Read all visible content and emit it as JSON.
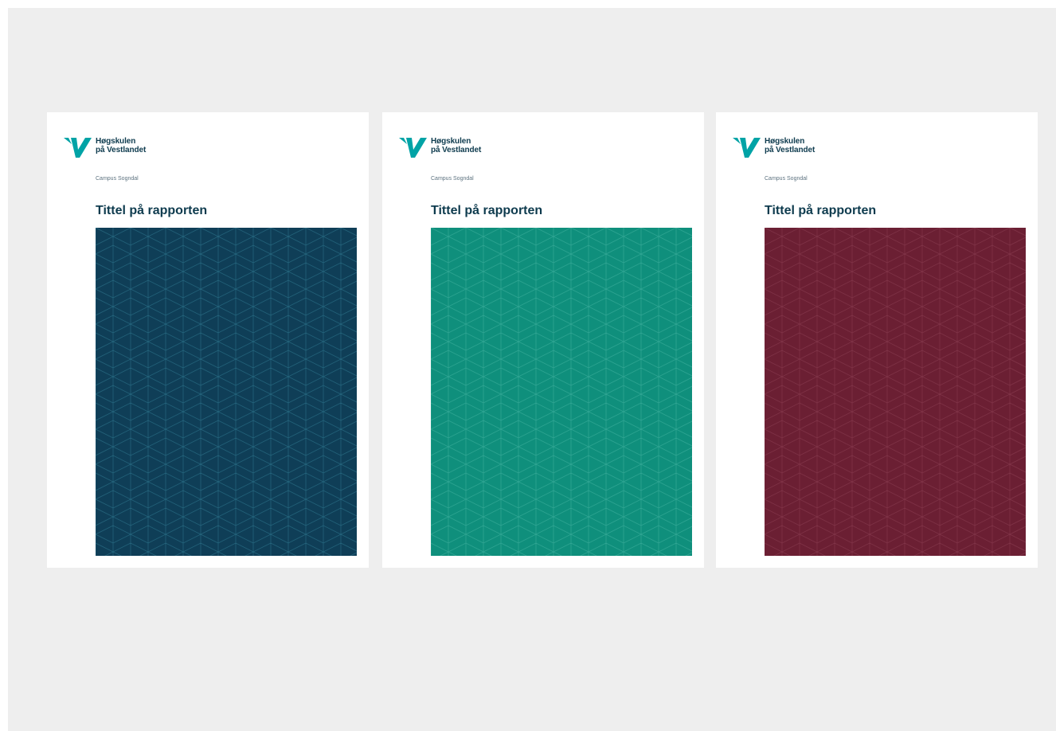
{
  "covers": [
    {
      "logo_line1": "Høgskulen",
      "logo_line2": "på Vestlandet",
      "campus": "Campus Sogndal",
      "title": "Tittel på rapporten",
      "panel_color": "#0f3e57",
      "pattern_color": "#2b6f86"
    },
    {
      "logo_line1": "Høgskulen",
      "logo_line2": "på Vestlandet",
      "campus": "Campus Sogndal",
      "title": "Tittel på rapporten",
      "panel_color": "#0f8f7c",
      "pattern_color": "#3aab99"
    },
    {
      "logo_line1": "Høgskulen",
      "logo_line2": "på Vestlandet",
      "campus": "Campus Sogndal",
      "title": "Tittel på rapporten",
      "panel_color": "#6b1f33",
      "pattern_color": "#86394d"
    }
  ],
  "brand": {
    "logo_color": "#00a3a6",
    "text_color": "#0e3b4e",
    "background": "#eeeeee"
  }
}
